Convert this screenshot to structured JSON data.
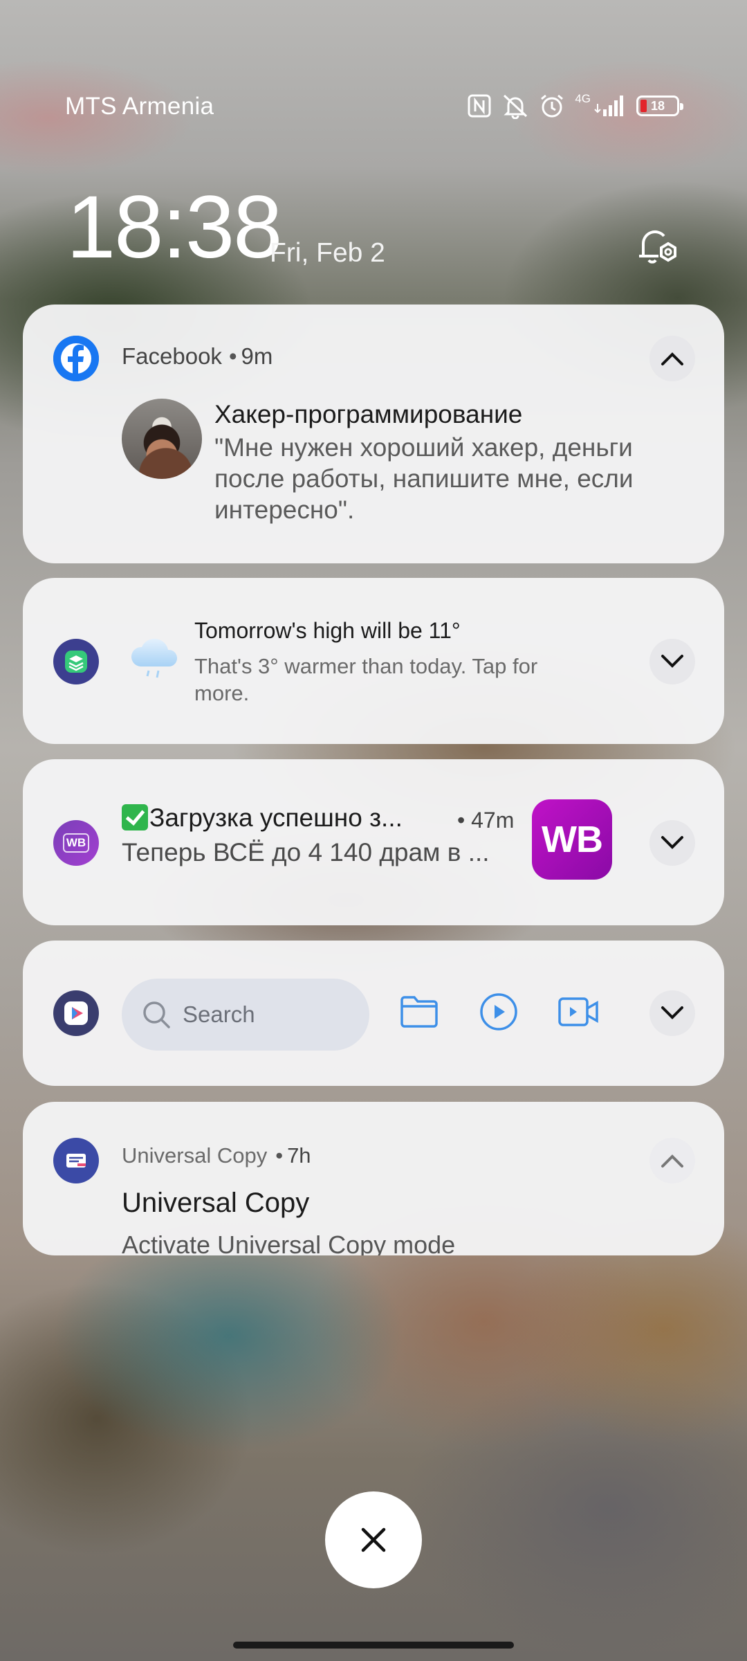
{
  "status_bar": {
    "carrier": "MTS Armenia",
    "network_type": "4G",
    "battery_level": "18",
    "icons": [
      "nfc-icon",
      "bell-muted-icon",
      "alarm-icon",
      "signal-icon",
      "battery-icon"
    ]
  },
  "lockscreen": {
    "time": "18:38",
    "date": "Fri, Feb 2"
  },
  "notifications": {
    "facebook": {
      "app": "Facebook",
      "separator": "•",
      "time": "9m",
      "title": "Хакер-программирование",
      "text": "\"Мне нужен хороший хакер, деньги после работы, напишите мне, если интересно\"."
    },
    "weather": {
      "title": "Tomorrow's high will be 11°",
      "text": "That's 3° warmer than today. Tap for more."
    },
    "wildberries": {
      "app_icon_text": "WB",
      "title": "Загрузка успешно з...",
      "separator": "•",
      "time": "47m",
      "text": "Теперь ВСЁ до 4 140 драм в ...",
      "logo_text": "WB"
    },
    "media": {
      "search_placeholder": "Search"
    },
    "universal_copy": {
      "app": "Universal Copy",
      "separator": "•",
      "time": "7h",
      "title": "Universal Copy",
      "text": "Activate Universal Copy mode"
    }
  },
  "colors": {
    "facebook_blue": "#1877f2",
    "wb_purple": "#c012c7",
    "media_accent": "#3d8fe8",
    "battery_low": "#e3242b"
  }
}
